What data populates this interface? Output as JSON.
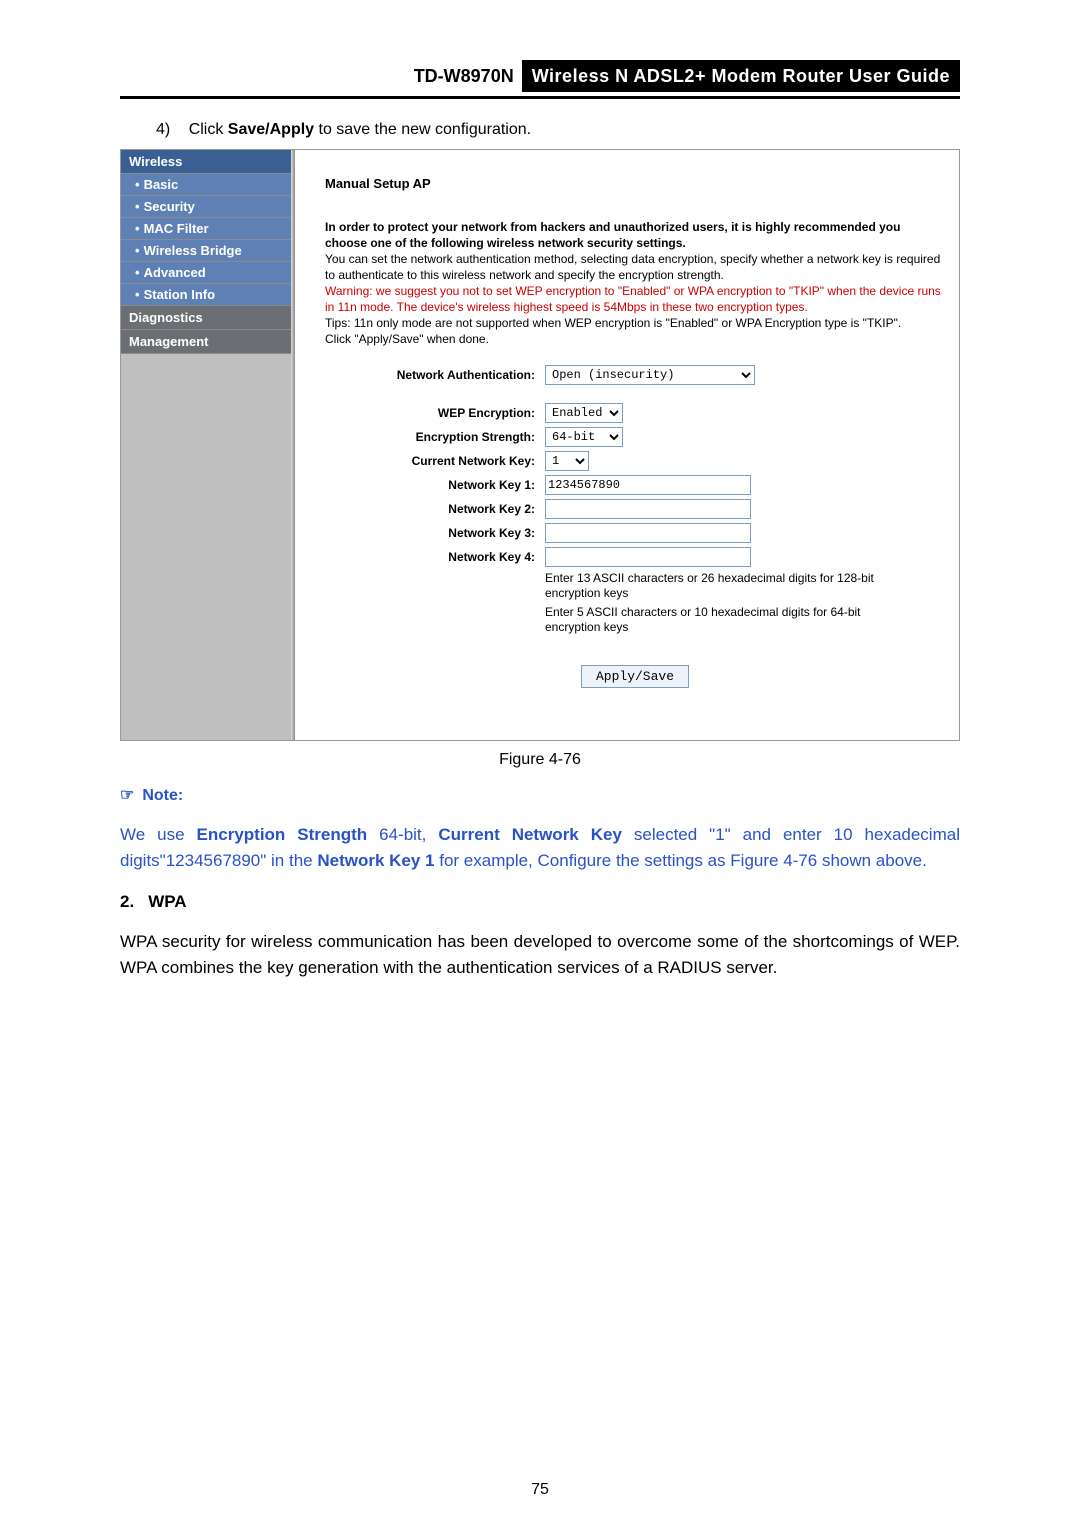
{
  "header": {
    "model": "TD-W8970N",
    "guide_title": "Wireless N ADSL2+ Modem Router User Guide"
  },
  "step": {
    "num": "4)",
    "text_before": "Click ",
    "bold": "Save/Apply",
    "text_after": " to save the new configuration."
  },
  "sidebar": {
    "header": "Wireless",
    "items": [
      "Basic",
      "Security",
      "MAC Filter",
      "Wireless Bridge",
      "Advanced",
      "Station Info"
    ],
    "plain": [
      "Diagnostics",
      "Management"
    ]
  },
  "panel": {
    "title": "Manual Setup AP",
    "intro_bold": "In order to protect your network from hackers and unauthorized users, it is highly recommended you choose one of the following wireless network security settings.",
    "intro_plain": "You can set the network authentication method, selecting data encryption, specify whether a network key is required to authenticate to this wireless network and specify the encryption strength.",
    "intro_warn": "Warning: we suggest you not to set WEP encryption to \"Enabled\" or WPA encryption to \"TKIP\" when the device runs in 11n mode. The device's wireless highest speed is 54Mbps in these two encryption types.",
    "intro_tip": "Tips: 11n only mode are not supported when WEP encryption is \"Enabled\" or WPA Encryption type is \"TKIP\".",
    "intro_click": "Click \"Apply/Save\" when done.",
    "labels": {
      "net_auth": "Network Authentication:",
      "wep": "WEP Encryption:",
      "enc_str": "Encryption Strength:",
      "cur_key": "Current Network Key:",
      "k1": "Network Key 1:",
      "k2": "Network Key 2:",
      "k3": "Network Key 3:",
      "k4": "Network Key 4:"
    },
    "values": {
      "net_auth": "Open (insecurity)",
      "wep": "Enabled",
      "enc_str": "64-bit",
      "cur_key": "1",
      "k1": "1234567890",
      "k2": "",
      "k3": "",
      "k4": ""
    },
    "hint1": "Enter 13 ASCII characters or 26 hexadecimal digits for 128-bit encryption keys",
    "hint2": "Enter 5 ASCII characters or 10 hexadecimal digits for 64-bit encryption keys",
    "button": "Apply/Save"
  },
  "caption": "Figure 4-76",
  "note": {
    "header_icon": "☞",
    "header": "Note:",
    "body_parts": {
      "p1": "We use ",
      "b1": "Encryption Strength",
      "p2": " 64-bit, ",
      "b2": "Current Network Key",
      "p3": " selected \"1\" and enter 10 hexadecimal digits\"1234567890\" in the ",
      "b3": "Network Key 1",
      "p4": " for example, Configure the settings as Figure 4-76 shown above."
    }
  },
  "section2": {
    "num": "2.",
    "title": "WPA",
    "body": "WPA security for wireless communication has been developed to overcome some of the shortcomings of WEP. WPA combines the key generation with the authentication services of a RADIUS server."
  },
  "page_number": "75"
}
